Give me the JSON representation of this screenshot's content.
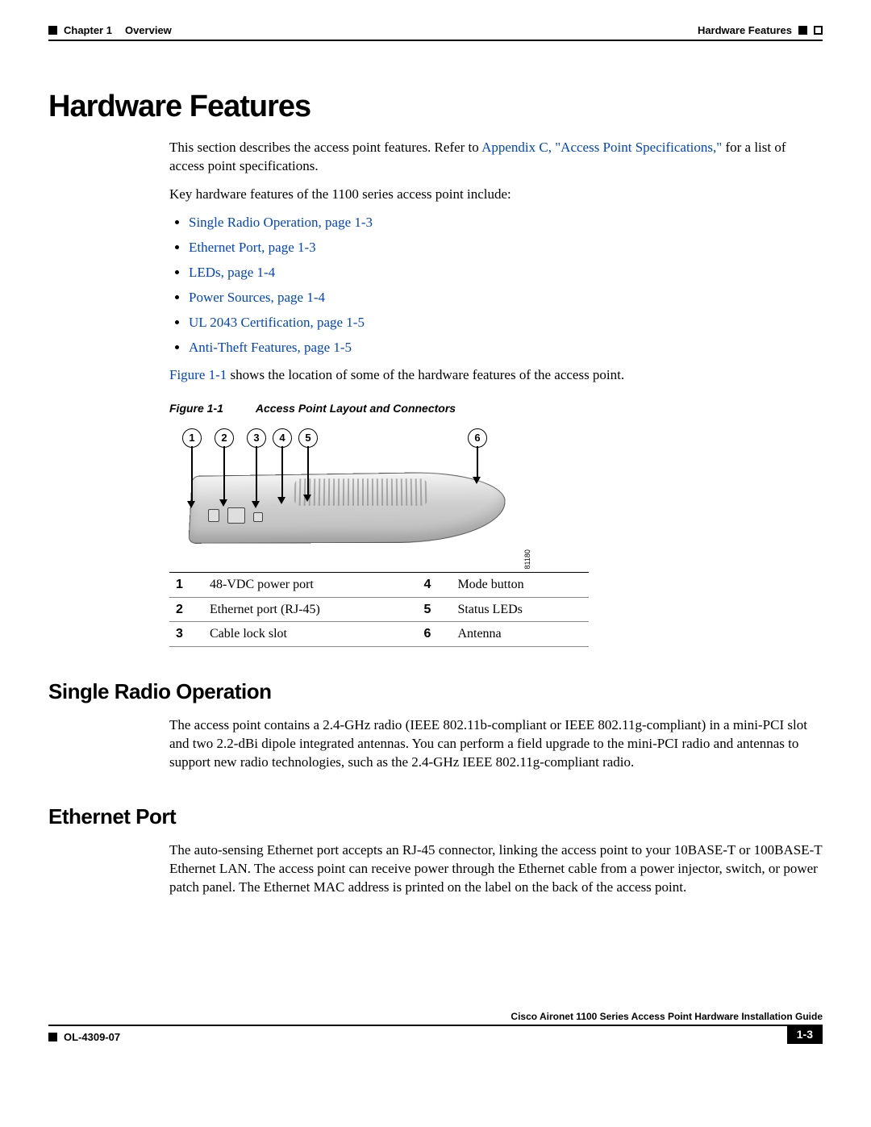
{
  "header": {
    "chapter": "Chapter 1",
    "chapter_title": "Overview",
    "section": "Hardware Features"
  },
  "h1": "Hardware Features",
  "intro": {
    "pre_link": "This section describes the access point features. Refer to ",
    "link": "Appendix C, \"Access Point Specifications,\"",
    "post_link": " for a list of access point specifications."
  },
  "key_intro": "Key hardware features of the 1100 series access point include:",
  "bullets": [
    "Single Radio Operation, page 1-3",
    "Ethernet Port, page 1-3",
    "LEDs, page 1-4",
    "Power Sources, page 1-4",
    "UL 2043 Certification, page 1-5",
    "Anti-Theft Features, page 1-5"
  ],
  "fig_ref": {
    "link": "Figure 1-1",
    "rest": " shows the location of some of the hardware features of the access point."
  },
  "figure": {
    "num": "Figure 1-1",
    "title": "Access Point Layout and Connectors",
    "code": "81180",
    "callouts": [
      "1",
      "2",
      "3",
      "4",
      "5",
      "6"
    ]
  },
  "table": {
    "rows": [
      {
        "n1": "1",
        "l1": "48-VDC power port",
        "n2": "4",
        "l2": "Mode button"
      },
      {
        "n1": "2",
        "l1": "Ethernet port (RJ-45)",
        "n2": "5",
        "l2": "Status LEDs"
      },
      {
        "n1": "3",
        "l1": "Cable lock slot",
        "n2": "6",
        "l2": "Antenna"
      }
    ]
  },
  "sections": [
    {
      "title": "Single Radio Operation",
      "body": "The access point contains a 2.4-GHz radio (IEEE 802.11b-compliant or IEEE 802.11g-compliant) in a mini-PCI slot and two 2.2-dBi dipole integrated antennas. You can perform a field upgrade to the mini-PCI radio and antennas to support new radio technologies, such as the 2.4-GHz IEEE 802.11g-compliant radio."
    },
    {
      "title": "Ethernet Port",
      "body": "The auto-sensing Ethernet port accepts an RJ-45 connector, linking the access point to your 10BASE-T or 100BASE-T Ethernet LAN. The access point can receive power through the Ethernet cable from a power injector, switch, or power patch panel. The Ethernet MAC address is printed on the label on the back of the access point."
    }
  ],
  "footer": {
    "guide": "Cisco Aironet 1100 Series Access Point Hardware Installation Guide",
    "ol": "OL-4309-07",
    "page": "1-3"
  }
}
